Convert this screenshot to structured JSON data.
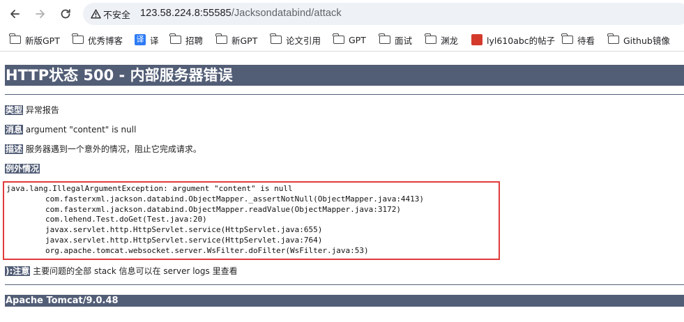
{
  "browser": {
    "security_label": "不安全",
    "url_host": "123.58.224.8:55585",
    "url_path": "/Jacksondatabind/attack",
    "bookmarks": [
      {
        "label": "新版GPT",
        "icon": "folder-icon"
      },
      {
        "label": "优秀博客",
        "icon": "folder-icon"
      },
      {
        "label": "译",
        "icon": "translate-icon",
        "badge": "译"
      },
      {
        "label": "招聘",
        "icon": "folder-icon"
      },
      {
        "label": "新GPT",
        "icon": "folder-icon"
      },
      {
        "label": "论文引用",
        "icon": "folder-icon"
      },
      {
        "label": "GPT",
        "icon": "folder-icon"
      },
      {
        "label": "面试",
        "icon": "folder-icon"
      },
      {
        "label": "渊龙",
        "icon": "folder-icon"
      },
      {
        "label": "lyl610abc的帖子",
        "icon": "site-icon"
      },
      {
        "label": "待看",
        "icon": "folder-icon"
      },
      {
        "label": "Github镜像",
        "icon": "folder-icon"
      }
    ]
  },
  "page": {
    "title": "HTTP状态 500 - 内部服务器错误",
    "type_label": "类型",
    "type_value": "异常报告",
    "message_label": "消息",
    "message_value": "argument \"content\" is null",
    "description_label": "描述",
    "description_value": "服务器遇到一个意外的情况，阻止它完成请求。",
    "exception_label": "例外情况",
    "exception_header": "java.lang.IllegalArgumentException: argument \"content\" is null",
    "stack_frames": [
      "com.fasterxml.jackson.databind.ObjectMapper._assertNotNull(ObjectMapper.java:4413)",
      "com.fasterxml.jackson.databind.ObjectMapper.readValue(ObjectMapper.java:3172)",
      "com.lehend.Test.doGet(Test.java:20)",
      "javax.servlet.http.HttpServlet.service(HttpServlet.java:655)",
      "javax.servlet.http.HttpServlet.service(HttpServlet.java:764)",
      "org.apache.tomcat.websocket.server.WsFilter.doFilter(WsFilter.java:53)"
    ],
    "note_label": "):注意",
    "note_value": "主要问题的全部 stack 信息可以在 server logs 里查看",
    "footer": "Apache Tomcat/9.0.48"
  },
  "colors": {
    "tomcat_header": "#525d76",
    "highlight_border": "#e03a3a"
  }
}
